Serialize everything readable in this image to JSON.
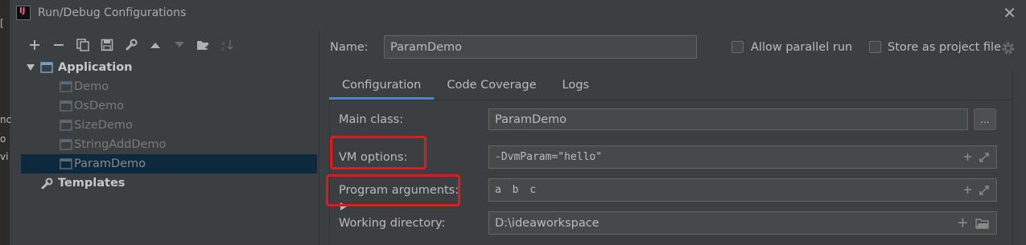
{
  "window": {
    "title": "Run/Debug Configurations",
    "app_icon_text": "IJ"
  },
  "edge_fragments": [
    "[",
    "nc",
    "o",
    "vi"
  ],
  "tree": {
    "group": "Application",
    "items": [
      "Demo",
      "OsDemo",
      "SizeDemo",
      "StringAddDemo",
      "ParamDemo"
    ],
    "selected": "ParamDemo",
    "templates": "Templates"
  },
  "form": {
    "name_label": "Name:",
    "name_value": "ParamDemo",
    "allow_parallel_label": "Allow parallel run",
    "allow_parallel_checked": false,
    "store_project_label": "Store as project file",
    "store_project_checked": false
  },
  "tabs": [
    "Configuration",
    "Code Coverage",
    "Logs"
  ],
  "active_tab": "Configuration",
  "config": {
    "main_class_label": "Main class:",
    "main_class_value": "ParamDemo",
    "browse_label": "...",
    "vm_options_label": "VM options:",
    "vm_options_value": "-DvmParam=\"hello\"",
    "program_args_label": "Program arguments:",
    "program_args_value": "a b c",
    "working_dir_label": "Working directory:",
    "working_dir_value": "D:\\ideaworkspace"
  },
  "colors": {
    "background": "#3c3f41",
    "selection": "#0d293e",
    "tab_underline": "#4a88c7",
    "highlight": "#e11b1b"
  }
}
